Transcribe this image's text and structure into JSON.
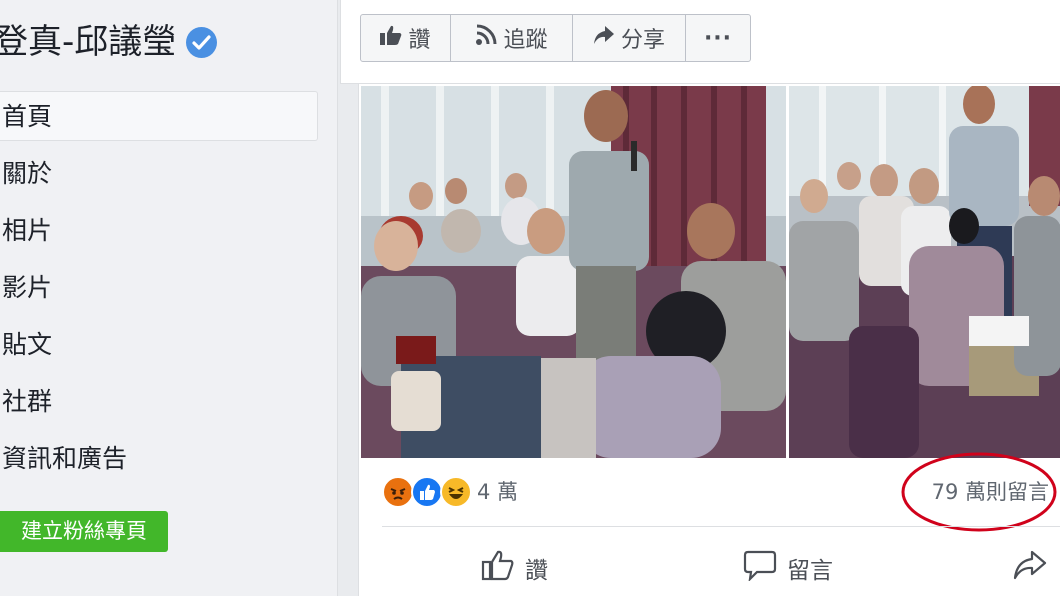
{
  "sidebar": {
    "page_name": "登真-邱議瑩",
    "nav": [
      {
        "label": "首頁",
        "active": true
      },
      {
        "label": "關於"
      },
      {
        "label": "相片"
      },
      {
        "label": "影片"
      },
      {
        "label": "貼文"
      },
      {
        "label": "社群"
      },
      {
        "label": "資訊和廣告"
      }
    ],
    "create_page_label": "建立粉絲專頁"
  },
  "action_bar": {
    "like_label": "讚",
    "follow_label": "追蹤",
    "share_label": "分享",
    "more_label": "···"
  },
  "post": {
    "reaction_count": "4 萬",
    "reactions": [
      "angry",
      "like",
      "haha"
    ],
    "comment_count": "79 萬則留言",
    "actions": {
      "like_label": "讚",
      "comment_label": "留言"
    }
  },
  "colors": {
    "verified": "#4a90e2",
    "create_button": "#42b72a",
    "highlight": "#d0021b",
    "like_reaction": "#1877f2",
    "haha_reaction": "#f7b928",
    "angry_reaction": "#e9710f"
  }
}
